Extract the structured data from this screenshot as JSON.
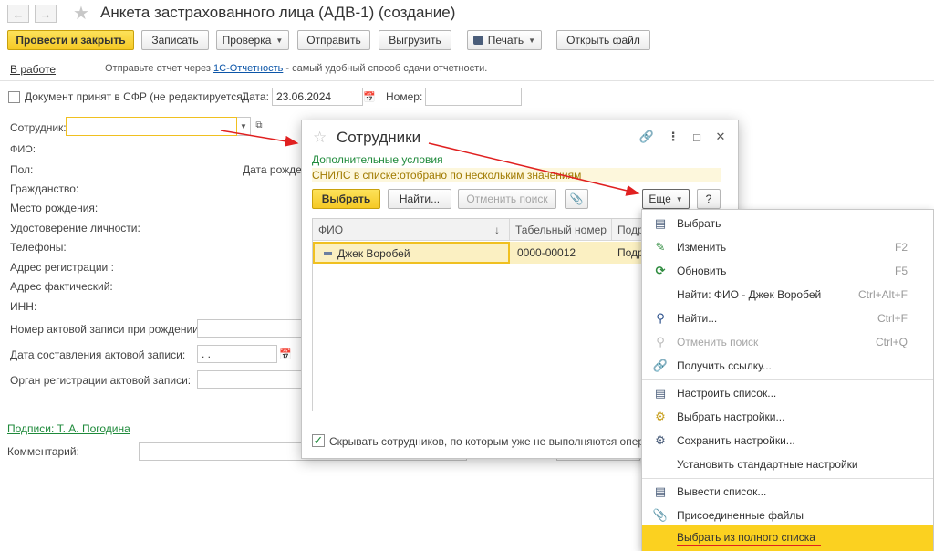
{
  "header": {
    "title": "Анкета застрахованного лица (АДВ-1) (создание)",
    "back_icon": "arrow-left-icon",
    "forward_icon": "arrow-right-icon",
    "star_icon": "star-icon"
  },
  "toolbar": {
    "post_close": "Провести и закрыть",
    "save": "Записать",
    "check": "Проверка",
    "send": "Отправить",
    "export": "Выгрузить",
    "print": "Печать",
    "open_file": "Открыть файл"
  },
  "status": {
    "state": "В работе",
    "hint_prefix": "Отправьте отчет через ",
    "hint_link": "1С-Отчетность",
    "hint_suffix": " - самый удобный способ сдачи отчетности."
  },
  "form": {
    "accepted_label": "Документ принят в СФР (не редактируется)",
    "date_label": "Дата:",
    "date_value": "23.06.2024",
    "number_label": "Номер:",
    "employee_label": "Сотрудник:",
    "fio_label": "ФИО:",
    "gender_label": "Пол:",
    "birthdate_label": "Дата рожде",
    "citizenship_label": "Гражданство:",
    "birthplace_label": "Место рождения:",
    "id_doc_label": "Удостоверение личности:",
    "phones_label": "Телефоны:",
    "reg_address_label": "Адрес регистрации :",
    "actual_address_label": "Адрес фактический:",
    "inn_label": "ИНН:",
    "birth_record_label": "Номер актовой записи при рождении:",
    "record_date_label": "Дата составления актовой записи:",
    "record_date_value": " .  .",
    "record_org_label": "Орган регистрации актовой записи:",
    "signatures_link": "Подписи: Т. А. Погодина",
    "comment_label": "Комментарий:"
  },
  "dialog": {
    "title": "Сотрудники",
    "extra_conditions": "Дополнительные условия",
    "filter_text": "СНИЛС в списке:отобрано по нескольким значениям",
    "select_btn": "Выбрать",
    "find_btn": "Найти...",
    "cancel_search_btn": "Отменить поиск",
    "more_btn": "Еще",
    "help_btn": "?",
    "columns": [
      "ФИО",
      "Табельный номер",
      "Подр"
    ],
    "sort_indicator": "↓",
    "rows": [
      {
        "fio": "Джек Воробей",
        "tab": "0000-00012",
        "dept": "Подр"
      }
    ],
    "hide_label": "Скрывать сотрудников, по которым уже не выполняются операци"
  },
  "menu": {
    "items": [
      {
        "label": "Выбрать",
        "shortcut": "",
        "icon": "select-icon",
        "disabled": false
      },
      {
        "label": "Изменить",
        "shortcut": "F2",
        "icon": "pencil-icon",
        "disabled": false
      },
      {
        "label": "Обновить",
        "shortcut": "F5",
        "icon": "refresh-icon",
        "disabled": false
      },
      {
        "label": "Найти: ФИО - Джек Воробей",
        "shortcut": "Ctrl+Alt+F",
        "icon": "",
        "disabled": false
      },
      {
        "label": "Найти...",
        "shortcut": "Ctrl+F",
        "icon": "search-icon",
        "disabled": false
      },
      {
        "label": "Отменить поиск",
        "shortcut": "Ctrl+Q",
        "icon": "cancel-search-icon",
        "disabled": true
      },
      {
        "label": "Получить ссылку...",
        "shortcut": "",
        "icon": "link-icon",
        "disabled": false
      },
      {
        "label": "Настроить список...",
        "shortcut": "",
        "icon": "list-settings-icon",
        "disabled": false
      },
      {
        "label": "Выбрать настройки...",
        "shortcut": "",
        "icon": "load-settings-icon",
        "disabled": false
      },
      {
        "label": "Сохранить настройки...",
        "shortcut": "",
        "icon": "save-settings-icon",
        "disabled": false
      },
      {
        "label": "Установить стандартные настройки",
        "shortcut": "",
        "icon": "",
        "disabled": false
      },
      {
        "label": "Вывести список...",
        "shortcut": "",
        "icon": "export-list-icon",
        "disabled": false
      },
      {
        "label": "Присоединенные файлы",
        "shortcut": "",
        "icon": "paperclip-icon",
        "disabled": false
      },
      {
        "label": "Выбрать из полного списка",
        "shortcut": "",
        "icon": "",
        "disabled": false
      }
    ]
  },
  "colors": {
    "accent_yellow": "#f5c925",
    "link_blue": "#0b55a8",
    "filter_green": "#1f8a3b",
    "annotation_red": "#e02020"
  }
}
